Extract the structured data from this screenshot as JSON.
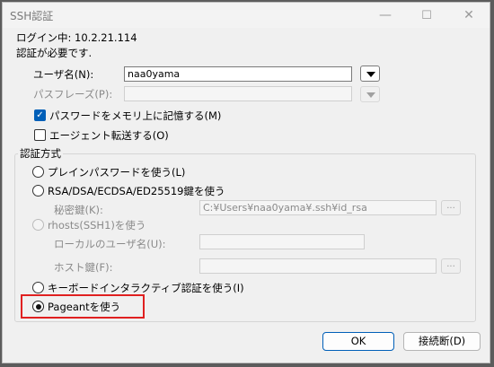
{
  "window": {
    "title": "SSH認証",
    "minimize_glyph": "—",
    "maximize_glyph": "☐",
    "close_glyph": "✕"
  },
  "status": {
    "login_line": "ログイン中: 10.2.21.114",
    "auth_required": "認証が必要です."
  },
  "form": {
    "username_label": "ユーザ名(N):",
    "username_value": "naa0yama",
    "passphrase_label": "パスフレーズ(P):",
    "passphrase_value": "",
    "remember_label": "パスワードをメモリ上に記憶する(M)",
    "remember_checked": true,
    "agent_forward_label": "エージェント転送する(O)",
    "agent_forward_checked": false
  },
  "auth_method": {
    "group_title": "認証方式",
    "plain_password": "プレインパスワードを使う(L)",
    "rsa_keys": "RSA/DSA/ECDSA/ED25519鍵を使う",
    "private_key_label": "秘密鍵(K):",
    "private_key_value": "C:¥Users¥naa0yama¥.ssh¥id_rsa",
    "rhosts": "rhosts(SSH1)を使う",
    "local_user_label": "ローカルのユーザ名(U):",
    "local_user_value": "",
    "host_key_label": "ホスト鍵(F):",
    "host_key_value": "",
    "keyboard_interactive": "キーボードインタラクティブ認証を使う(I)",
    "pageant": "Pageantを使う",
    "selected": "pageant"
  },
  "buttons": {
    "ellipsis": "...",
    "ok": "OK",
    "disconnect": "接続断(D)"
  },
  "colors": {
    "accent": "#005fb8",
    "highlight": "#e02020"
  }
}
